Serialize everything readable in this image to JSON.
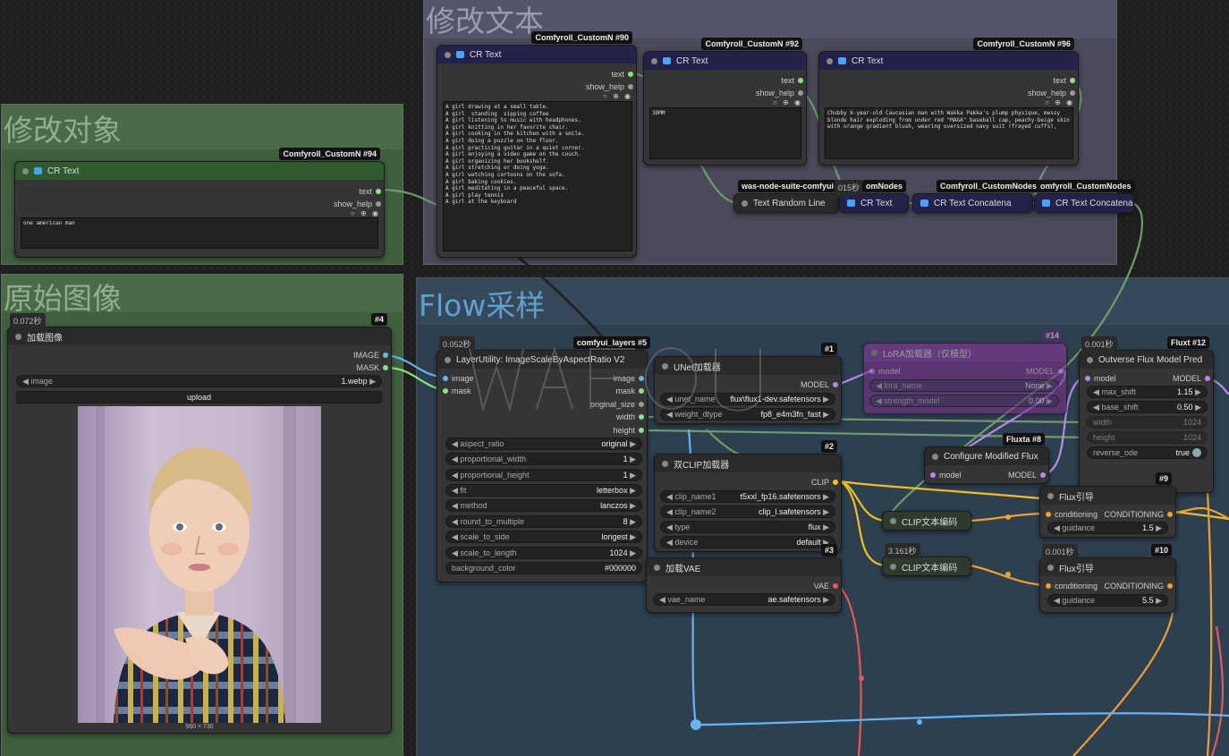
{
  "groups": {
    "edit_text": {
      "title": "修改文本"
    },
    "edit_object": {
      "title": "修改对象"
    },
    "original": {
      "title": "原始图像"
    },
    "flow": {
      "title": "Flow采样"
    }
  },
  "n94": {
    "badge": "Comfyroll_CustomN #94",
    "title": "CR Text",
    "out1": "text",
    "out2": "show_help",
    "icons": "○ ⊕ ◉",
    "text": "one american man"
  },
  "n90": {
    "badge": "Comfyroll_CustomN #90",
    "title": "CR Text",
    "out1": "text",
    "out2": "show_help",
    "icons": "○ ⊕ ◉",
    "text": "A girl drawing at a small table.\nA girl  standing  sipping coffee\nA girl listening to music with headphones.\nA girl knitting in her favorite chair.\nA girl cooking in the kitchen with a smile.\nA girl doing a puzzle on the floor.\nA girl practicing guitar in a quiet corner.\nA girl enjoying a video game on the couch.\nA girl organizing her bookshelf.\nA girl stretching or doing yoga.\nA girl watching cartoons on the sofa.\nA girl baking cookies.\nA girl meditating in a peaceful space.\nA girl play tennis\nA girl at the keyboard"
  },
  "n92": {
    "badge": "Comfyroll_CustomN #92",
    "title": "CR Text",
    "out1": "text",
    "out2": "show_help",
    "icons": "○ ⊕ ◉",
    "text": "3DMM"
  },
  "n96": {
    "badge": "Comfyroll_CustomN #96",
    "title": "CR Text",
    "out1": "text",
    "out2": "show_help",
    "icons": "○ ⊕ ◉",
    "text": "Chubby 6-year-old Caucasian man with Wakka Pakka's plump physique, messy blonde hair exploding from under red \"MAGA\" baseball cap, peachy-beige skin with orange gradient blush, wearing oversized navy suit (frayed cuffs),"
  },
  "mini": {
    "random_line": {
      "badge": "was-node-suite-comfyui",
      "title": "Text Random Line"
    },
    "cr_text": {
      "badge": "omNodes",
      "time": "015秒",
      "title": "CR Text"
    },
    "concat1": {
      "badge": "Comfyroll_CustomNodes",
      "title": "CR Text Concatena"
    },
    "concat2": {
      "badge": "omfyroll_CustomNodes",
      "title": "CR Text Concatena"
    }
  },
  "n4": {
    "time": "0.072秒",
    "badge": "#4",
    "title": "加载图像",
    "out1": "IMAGE",
    "out2": "MASK",
    "image_label": "image",
    "image_value": "1.webp",
    "upload": "upload",
    "dims": "560 × 730"
  },
  "n5": {
    "time": "0.052秒",
    "badge": "comfyui_layers #5",
    "title": "LayerUtility: ImageScaleByAspectRatio V2",
    "in1": "image",
    "in2": "mask",
    "outs": [
      "image",
      "mask",
      "original_size",
      "width",
      "height"
    ],
    "widgets": [
      [
        "aspect_ratio",
        "original"
      ],
      [
        "proportional_width",
        "1"
      ],
      [
        "proportional_height",
        "1"
      ],
      [
        "fit",
        "letterbox"
      ],
      [
        "method",
        "lanczos"
      ],
      [
        "round_to_multiple",
        "8"
      ],
      [
        "scale_to_side",
        "longest"
      ],
      [
        "scale_to_length",
        "1024"
      ],
      [
        "background_color",
        "#000000"
      ]
    ]
  },
  "n1": {
    "badge": "#1",
    "title": "UNet加载器",
    "out": "MODEL",
    "widgets": [
      [
        "unet_name",
        "flux\\flux1-dev.safetensors"
      ],
      [
        "weight_dtype",
        "fp8_e4m3fn_fast"
      ]
    ]
  },
  "n2": {
    "badge": "#2",
    "title": "双CLIP加载器",
    "out": "CLIP",
    "widgets": [
      [
        "clip_name1",
        "t5xxl_fp16.safetensors"
      ],
      [
        "clip_name2",
        "clip_l.safetensors"
      ],
      [
        "type",
        "flux"
      ],
      [
        "device",
        "default"
      ]
    ]
  },
  "n3": {
    "badge": "#3",
    "title": "加载VAE",
    "out": "VAE",
    "widgets": [
      [
        "vae_name",
        "ae.safetensors"
      ]
    ]
  },
  "lora": {
    "badge": "#14",
    "title": "LoRA加载器（仅模型）",
    "in": "model",
    "out": "MODEL",
    "widgets": [
      [
        "lora_name",
        "None"
      ],
      [
        "strength_model",
        "0.00"
      ]
    ]
  },
  "n8": {
    "badge": "Fluxta #8",
    "title": "Configure Modified Flux",
    "in": "model",
    "out": "MODEL"
  },
  "n12": {
    "time": "0.001秒",
    "badge": "Fluxt #12",
    "title": "Outverse Flux Model Pred",
    "in": "model",
    "out": "MODEL",
    "widgets": [
      [
        "max_shift",
        "1.15"
      ],
      [
        "base_shift",
        "0.50"
      ],
      [
        "width",
        "1024"
      ],
      [
        "height",
        "1024"
      ],
      [
        "reverse_ode",
        "true"
      ]
    ]
  },
  "clip_a": {
    "title": "CLIP文本编码"
  },
  "clip_b": {
    "time": "3.161秒",
    "title": "CLIP文本编码"
  },
  "n9": {
    "badge": "#9",
    "title": "Flux引导",
    "in": "conditioning",
    "out": "CONDITIONING",
    "widget": [
      "guidance",
      "1.5"
    ]
  },
  "n10": {
    "time": "0.001秒",
    "badge": "#10",
    "title": "Flux引导",
    "in": "conditioning",
    "out": "CONDITIONING",
    "widget": [
      "guidance",
      "5.5"
    ]
  },
  "colors": {
    "green_group": "#3f5f3f",
    "purple_group": "#4a4a5a",
    "blue_group": "#2e3f4f",
    "wire_green": "#8ae08a",
    "wire_yellow": "#f0c020",
    "wire_orange": "#f0a030",
    "wire_blue": "#64b5f6",
    "wire_purple": "#b48ce8",
    "wire_red": "#e05a5a"
  }
}
